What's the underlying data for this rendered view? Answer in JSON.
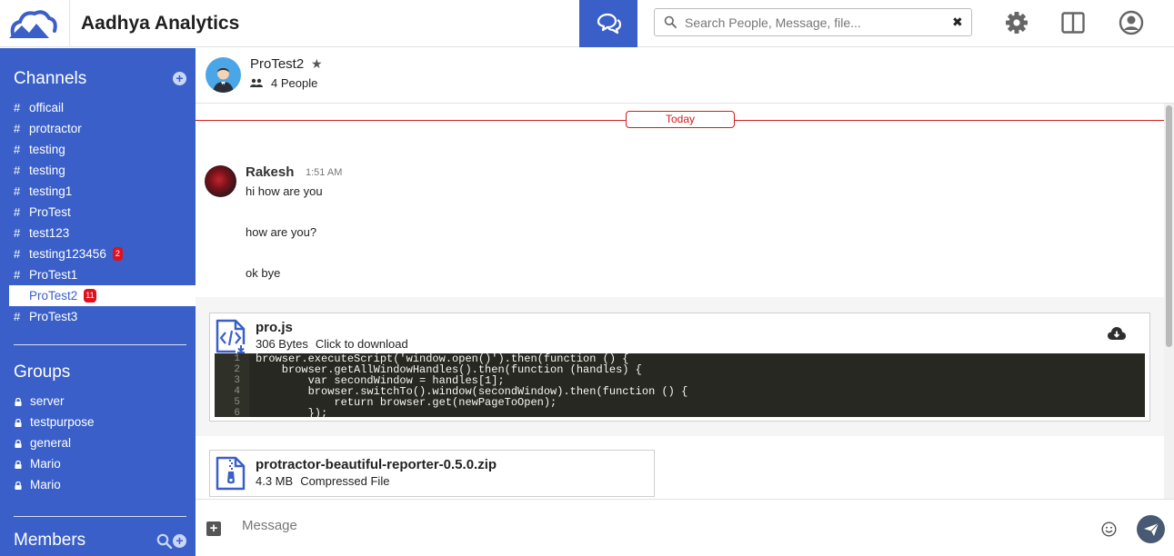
{
  "app": {
    "title": "Aadhya Analytics"
  },
  "header": {
    "search_placeholder": "Search People, Message, file...",
    "search_clear": "✖"
  },
  "colors": {
    "brand": "#3a5fc8",
    "badge": "#e0101e",
    "today": "#d41c1c"
  },
  "sidebar": {
    "channels_title": "Channels",
    "channels": [
      {
        "name": "officail",
        "badge": ""
      },
      {
        "name": "protractor",
        "badge": ""
      },
      {
        "name": "testing",
        "badge": ""
      },
      {
        "name": "testing",
        "badge": ""
      },
      {
        "name": "testing1",
        "badge": ""
      },
      {
        "name": "ProTest",
        "badge": ""
      },
      {
        "name": "test123",
        "badge": ""
      },
      {
        "name": "testing123456",
        "badge": "2"
      },
      {
        "name": "ProTest1",
        "badge": ""
      },
      {
        "name": "ProTest2",
        "badge": "11",
        "active": true
      },
      {
        "name": "ProTest3",
        "badge": ""
      }
    ],
    "groups_title": "Groups",
    "groups": [
      {
        "name": "server"
      },
      {
        "name": "testpurpose"
      },
      {
        "name": "general"
      },
      {
        "name": "Mario"
      },
      {
        "name": "Mario"
      }
    ],
    "members_title": "Members"
  },
  "room": {
    "name": "ProTest2",
    "star": "★",
    "people": "4 People"
  },
  "messages": {
    "today_label": "Today",
    "author": "Rakesh",
    "time": "1:51 AM",
    "lines": [
      "hi how are you",
      "how are you?",
      "ok bye"
    ]
  },
  "files": [
    {
      "name": "pro.js",
      "size": "306 Bytes",
      "action": "Click to download",
      "code": [
        {
          "n": "1",
          "text": "browser.executeScript('window.open()').then(function () {"
        },
        {
          "n": "2",
          "text": "    browser.getAllWindowHandles().then(function (handles) {"
        },
        {
          "n": "3",
          "text": "        var secondWindow = handles[1];"
        },
        {
          "n": "4",
          "text": "        browser.switchTo().window(secondWindow).then(function () {"
        },
        {
          "n": "5",
          "text": "            return browser.get(newPageToOpen);"
        },
        {
          "n": "6",
          "text": "        });"
        }
      ]
    },
    {
      "name": "protractor-beautiful-reporter-0.5.0.zip",
      "size": "4.3 MB",
      "type": "Compressed File"
    }
  ],
  "composer": {
    "placeholder": "Message"
  },
  "icons": {
    "logo": "mountain-logo",
    "chat": "chat-bubbles-icon",
    "settings": "gear-icon",
    "layout": "split-panel-icon",
    "profile": "user-circle-icon",
    "send": "paper-plane-icon"
  }
}
